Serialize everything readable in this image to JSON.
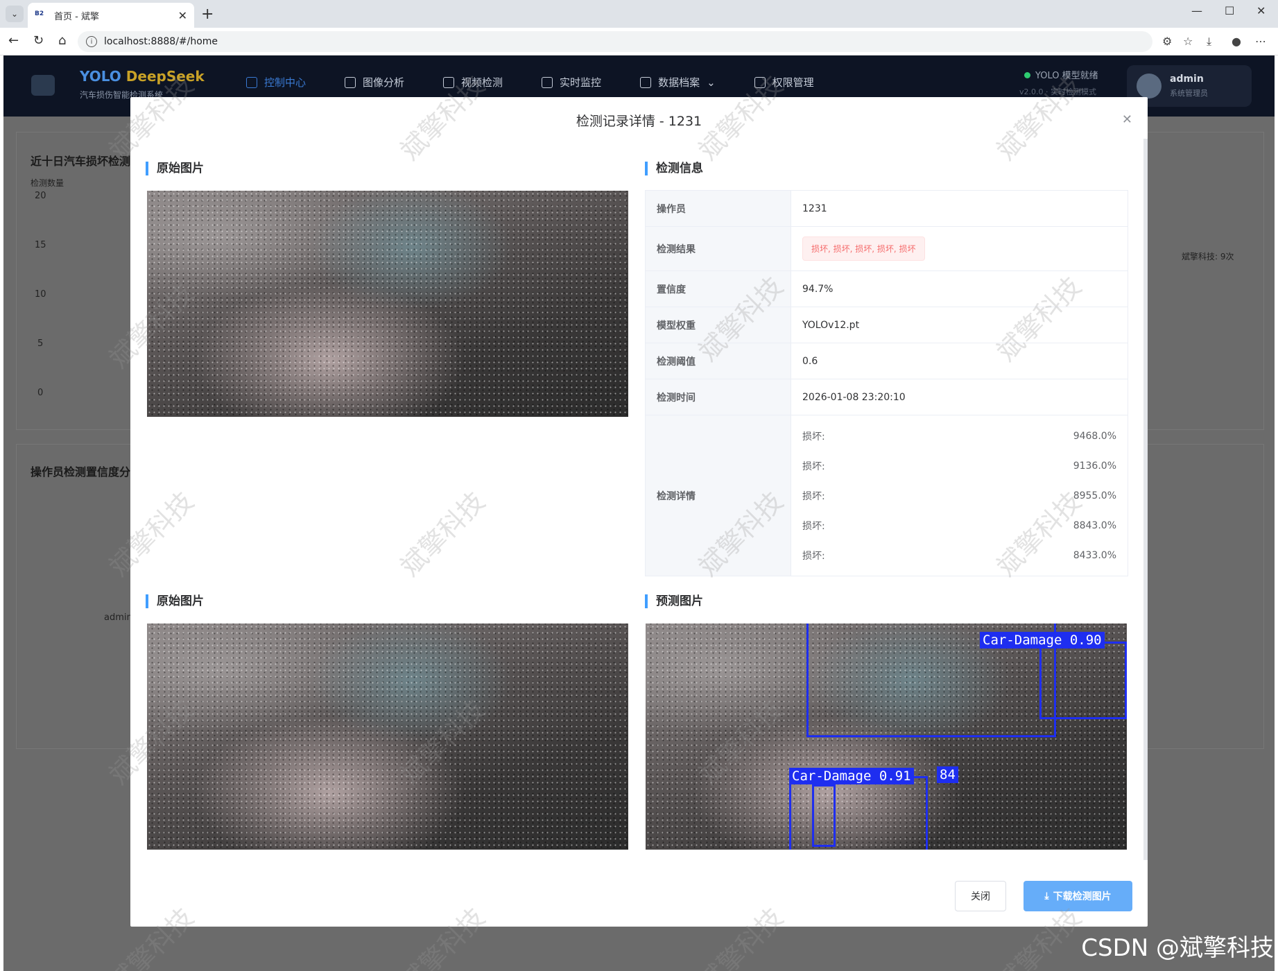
{
  "browser": {
    "tab_title": "首页 - 斌擎",
    "tab_favicon": "B2",
    "url": "localhost:8888/#/home"
  },
  "app": {
    "brand_main": "YOLO",
    "brand_accent": "DeepSeek",
    "brand_sub": "汽车损伤智能检测系统",
    "nav": [
      {
        "label": "控制中心",
        "icon": "home-icon"
      },
      {
        "label": "图像分析",
        "icon": "image-icon"
      },
      {
        "label": "视频检测",
        "icon": "play-icon"
      },
      {
        "label": "实时监控",
        "icon": "camera-icon"
      },
      {
        "label": "数据档案",
        "icon": "document-icon"
      },
      {
        "label": "权限管理",
        "icon": "user-icon"
      }
    ],
    "status_text": "YOLO 模型就绪",
    "status_sub": "v2.0.0 · 实时检测模式",
    "user_name": "admin",
    "user_role": "系统管理员"
  },
  "dashboard": {
    "chart1_title": "近十日汽车损坏检测",
    "chart1_ylabel": "检测数量",
    "chart1_yticks": [
      "20",
      "15",
      "10",
      "5",
      "0"
    ],
    "pie_label": "斌擎科技: 9次",
    "chart2_title": "操作员检测置信度分",
    "chart2_xlabel": "admin"
  },
  "modal": {
    "title": "检测记录详情 - 1231",
    "section_original_top": "原始图片",
    "section_info": "检测信息",
    "section_original_bottom": "原始图片",
    "section_predicted": "预测图片",
    "fields": [
      {
        "key": "操作员",
        "value": "1231"
      },
      {
        "key": "检测结果",
        "value": "损坏, 损坏, 损坏, 损坏, 损坏"
      },
      {
        "key": "置信度",
        "value": "94.7%"
      },
      {
        "key": "模型权重",
        "value": "YOLOv12.pt"
      },
      {
        "key": "检测阈值",
        "value": "0.6"
      },
      {
        "key": "检测时间",
        "value": "2026-01-08 23:20:10"
      }
    ],
    "details_key": "检测详情",
    "details": [
      {
        "label": "损坏:",
        "value": "9468.0%"
      },
      {
        "label": "损坏:",
        "value": "9136.0%"
      },
      {
        "label": "损坏:",
        "value": "8955.0%"
      },
      {
        "label": "损坏:",
        "value": "8843.0%"
      },
      {
        "label": "损坏:",
        "value": "8433.0%"
      }
    ],
    "detections": [
      {
        "label": "Car-Damage 0.90"
      },
      {
        "label": "Car-Damage 0.91"
      },
      {
        "label": "84"
      }
    ],
    "close_button": "关闭",
    "download_button": "下载检测图片",
    "accent_color": "#409eff",
    "danger_color": "#f56c6c"
  },
  "watermark_text": "斌擎科技",
  "csdn_text": "CSDN @斌擎科技"
}
